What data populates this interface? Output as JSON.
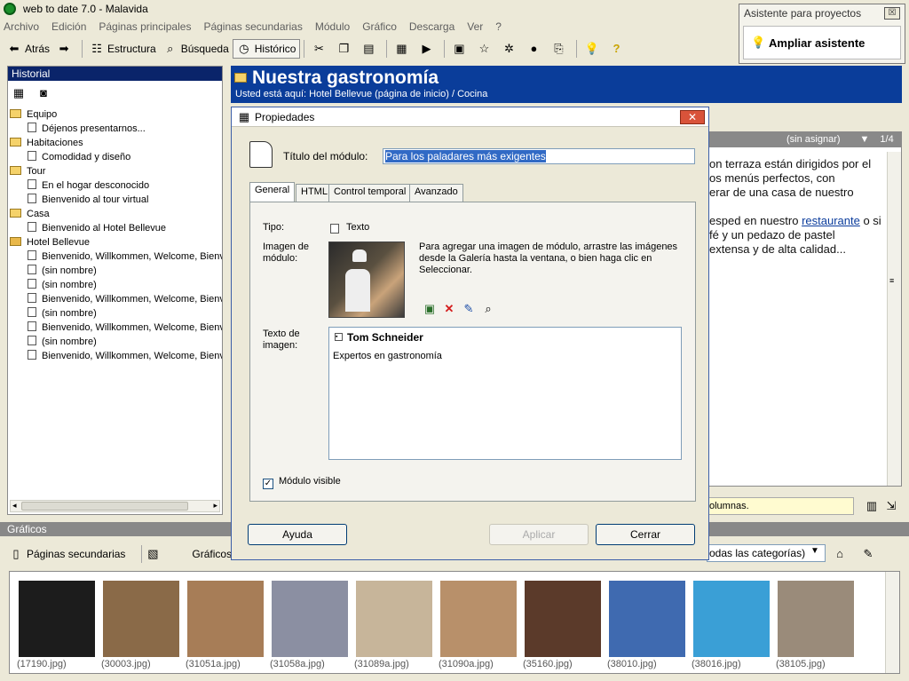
{
  "window": {
    "title": "web to date 7.0 - Malavida"
  },
  "menu": [
    "Archivo",
    "Edición",
    "Páginas principales",
    "Páginas secundarias",
    "Módulo",
    "Gráfico",
    "Descarga",
    "Ver",
    "?"
  ],
  "toolbar": {
    "back": "Atrás",
    "structure": "Estructura",
    "search": "Búsqueda",
    "history": "Histórico"
  },
  "assistant": {
    "title": "Asistente para proyectos",
    "close": "☒",
    "button": "Ampliar asistente"
  },
  "history_panel": {
    "title": "Historial",
    "items": [
      {
        "label": "Equipo",
        "kind": "folder",
        "indent": 0
      },
      {
        "label": "Déjenos presentarnos...",
        "kind": "page",
        "indent": 1
      },
      {
        "label": "Habitaciones",
        "kind": "folder",
        "indent": 0
      },
      {
        "label": "Comodidad y diseño",
        "kind": "page",
        "indent": 1
      },
      {
        "label": "Tour",
        "kind": "folder",
        "indent": 0
      },
      {
        "label": "En el hogar desconocido",
        "kind": "page",
        "indent": 1
      },
      {
        "label": "Bienvenido al tour virtual",
        "kind": "page",
        "indent": 1
      },
      {
        "label": "Casa",
        "kind": "folder",
        "indent": 0
      },
      {
        "label": "Bienvenido al Hotel Bellevue",
        "kind": "page",
        "indent": 1
      },
      {
        "label": "Hotel Bellevue",
        "kind": "home",
        "indent": 0
      },
      {
        "label": "Bienvenido, Willkommen, Welcome, Bienve",
        "kind": "page",
        "indent": 1
      },
      {
        "label": "(sin nombre)",
        "kind": "page",
        "indent": 1
      },
      {
        "label": "(sin nombre)",
        "kind": "page",
        "indent": 1
      },
      {
        "label": "Bienvenido, Willkommen, Welcome, Bienve",
        "kind": "page",
        "indent": 1
      },
      {
        "label": "(sin nombre)",
        "kind": "page",
        "indent": 1
      },
      {
        "label": "Bienvenido, Willkommen, Welcome, Bienve",
        "kind": "page",
        "indent": 1
      },
      {
        "label": "(sin nombre)",
        "kind": "page",
        "indent": 1
      },
      {
        "label": "Bienvenido, Willkommen, Welcome, Bienve",
        "kind": "page",
        "indent": 1
      }
    ]
  },
  "page_header": {
    "title": "Nuestra gastronomía",
    "breadcrumb": "Usted está aquí: Hotel Bellevue (página de inicio) / Cocina"
  },
  "module_bar": {
    "assignment": "(sin asignar)",
    "counter": "1/4"
  },
  "page_text": [
    "on terraza están dirigidos por el",
    "os menús perfectos, con",
    "erar de una casa de nuestro",
    "",
    "esped en nuestro ",
    "fé y un pedazo de pastel",
    "extensa y de alta calidad..."
  ],
  "page_link": "restaurante",
  "page_text_after_link": " o si",
  "hint_bar": "olumnas.",
  "graphics": {
    "header": "Gráficos",
    "tab_secondary": "Páginas secundarias",
    "tab_graphics": "Gráficos",
    "category": "odas las categorías)",
    "thumbs": [
      {
        "caption": "(17190.jpg)",
        "color": "#1c1c1c"
      },
      {
        "caption": "(30003.jpg)",
        "color": "#8a6a48"
      },
      {
        "caption": "(31051a.jpg)",
        "color": "#a77d57"
      },
      {
        "caption": "(31058a.jpg)",
        "color": "#8b8fa2"
      },
      {
        "caption": "(31089a.jpg)",
        "color": "#c7b59a"
      },
      {
        "caption": "(31090a.jpg)",
        "color": "#b8906a"
      },
      {
        "caption": "(35160.jpg)",
        "color": "#5b3a2a"
      },
      {
        "caption": "(38010.jpg)",
        "color": "#3f6ab0"
      },
      {
        "caption": "(38016.jpg)",
        "color": "#3a9fd6"
      },
      {
        "caption": "(38105.jpg)",
        "color": "#9a8b7a"
      }
    ]
  },
  "dialog": {
    "title": "Propiedades",
    "close": "✕",
    "module_title_label": "Título del módulo:",
    "module_title_value": "Para los paladares más exigentes",
    "tabs": [
      "General",
      "HTML",
      "Control temporal",
      "Avanzado"
    ],
    "type_label": "Tipo:",
    "type_value": "Texto",
    "image_label": "Imagen de módulo:",
    "image_hint": "Para agregar una imagen de módulo, arrastre las imágenes desde la Galería hasta la ventana, o bien haga clic en Seleccionar.",
    "caption_label": "Texto de imagen:",
    "caption_title": "Tom Schneider",
    "caption_body": "Expertos en gastronomía",
    "visible_label": "Módulo visible",
    "visible_checked": true,
    "btn_help": "Ayuda",
    "btn_apply": "Aplicar",
    "btn_close": "Cerrar"
  }
}
